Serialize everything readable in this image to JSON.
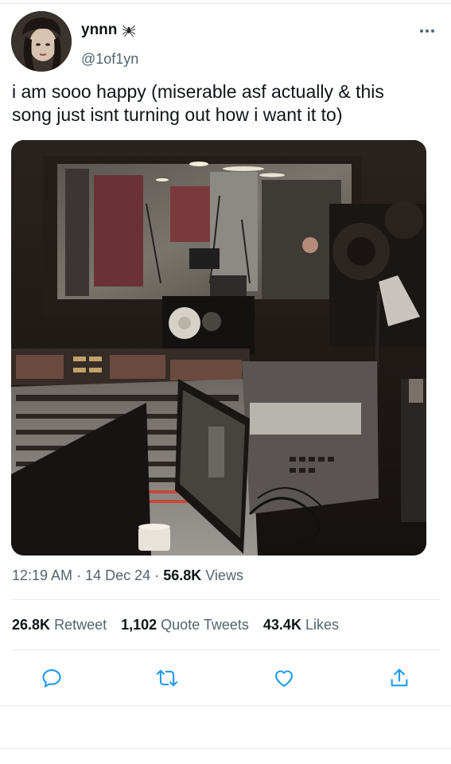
{
  "author": {
    "display_name": "ynnn",
    "emoji": "spider-icon",
    "handle": "@1of1yn"
  },
  "tweet": {
    "text": "i am sooo happy (miserable asf actually & this\nsong just isnt turning out how i want it to)"
  },
  "meta": {
    "time": "12:19 AM",
    "separator": "·",
    "date": "14 Dec 24",
    "views_count": "56.8K",
    "views_label": "Views"
  },
  "stats": {
    "retweets_count": "26.8K",
    "retweets_label": "Retweet",
    "quotes_count": "1,102",
    "quotes_label": "Quote Tweets",
    "likes_count": "43.4K",
    "likes_label": "Likes"
  },
  "actions": [
    "reply-icon",
    "retweet-icon",
    "like-icon",
    "share-icon"
  ],
  "colors": {
    "text_primary": "#0f1419",
    "text_secondary": "#536471",
    "divider": "#e6e9eb"
  }
}
